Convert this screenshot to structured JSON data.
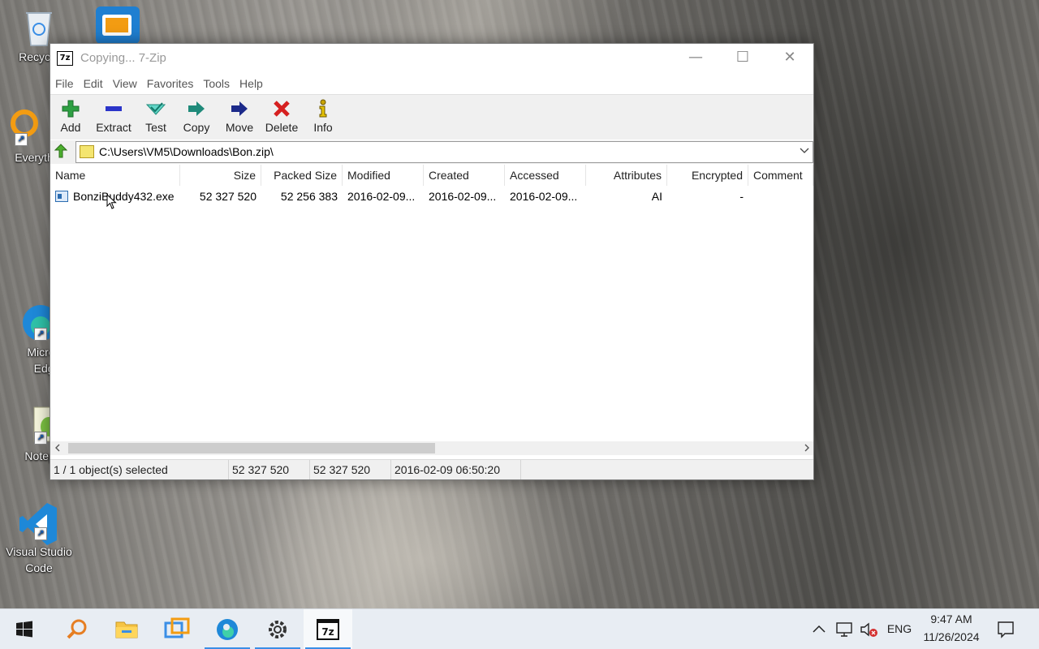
{
  "desktop": {
    "icons": [
      {
        "label": "Recycle",
        "icon": "recycle-bin-icon"
      },
      {
        "label": "Everyth",
        "icon": "everything-search-icon"
      },
      {
        "label": "Micros Edge",
        "line1": "Micros",
        "line2": "Edge",
        "icon": "edge-icon"
      },
      {
        "label": "Notepa",
        "icon": "notepad-plus-plus-icon"
      },
      {
        "label": "Visual Studio Code",
        "line1": "Visual Studio",
        "line2": "Code",
        "icon": "vscode-icon"
      }
    ]
  },
  "window": {
    "title": "Copying... 7-Zip",
    "app_icon_text": "7z",
    "controls": {
      "minimize": "—",
      "maximize": "☐",
      "close": "✕"
    }
  },
  "menu": [
    "File",
    "Edit",
    "View",
    "Favorites",
    "Tools",
    "Help"
  ],
  "toolbar": {
    "buttons": [
      {
        "label": "Add",
        "icon": "plus-icon",
        "color": "#2ea043"
      },
      {
        "label": "Extract",
        "icon": "minus-icon",
        "color": "#2b35c9"
      },
      {
        "label": "Test",
        "icon": "check-icon",
        "color": "#2fb8a8"
      },
      {
        "label": "Copy",
        "icon": "copy-arrow-icon",
        "color": "#1f8a7a"
      },
      {
        "label": "Move",
        "icon": "move-arrow-icon",
        "color": "#1c2a8a"
      },
      {
        "label": "Delete",
        "icon": "delete-x-icon",
        "color": "#d62020"
      },
      {
        "label": "Info",
        "icon": "info-icon",
        "color": "#c9a400"
      }
    ]
  },
  "address": {
    "path": "C:\\Users\\VM5\\Downloads\\Bon.zip\\"
  },
  "list": {
    "columns": [
      "Name",
      "Size",
      "Packed Size",
      "Modified",
      "Created",
      "Accessed",
      "Attributes",
      "Encrypted",
      "Comment"
    ],
    "rows": [
      {
        "name": "BonziBuddy432.exe",
        "size": "52 327 520",
        "packed_size": "52 256 383",
        "modified": "2016-02-09...",
        "created": "2016-02-09...",
        "accessed": "2016-02-09...",
        "attributes": "AI",
        "encrypted": "-",
        "comment": ""
      }
    ]
  },
  "status": {
    "selection": "1 / 1 object(s) selected",
    "size": "52 327 520",
    "packed": "52 327 520",
    "date": "2016-02-09 06:50:20"
  },
  "taskbar": {
    "apps": [
      "start-icon",
      "search-icon",
      "file-explorer-icon",
      "vmware-icon",
      "edge-icon",
      "settings-gear-icon",
      "7zip-icon"
    ],
    "language": "ENG",
    "time": "9:47 AM",
    "date": "11/26/2024"
  },
  "colors": {
    "accent": "#3a8ee6",
    "taskbar": "#e8edf3",
    "toolbar": "#f0f0f0"
  }
}
